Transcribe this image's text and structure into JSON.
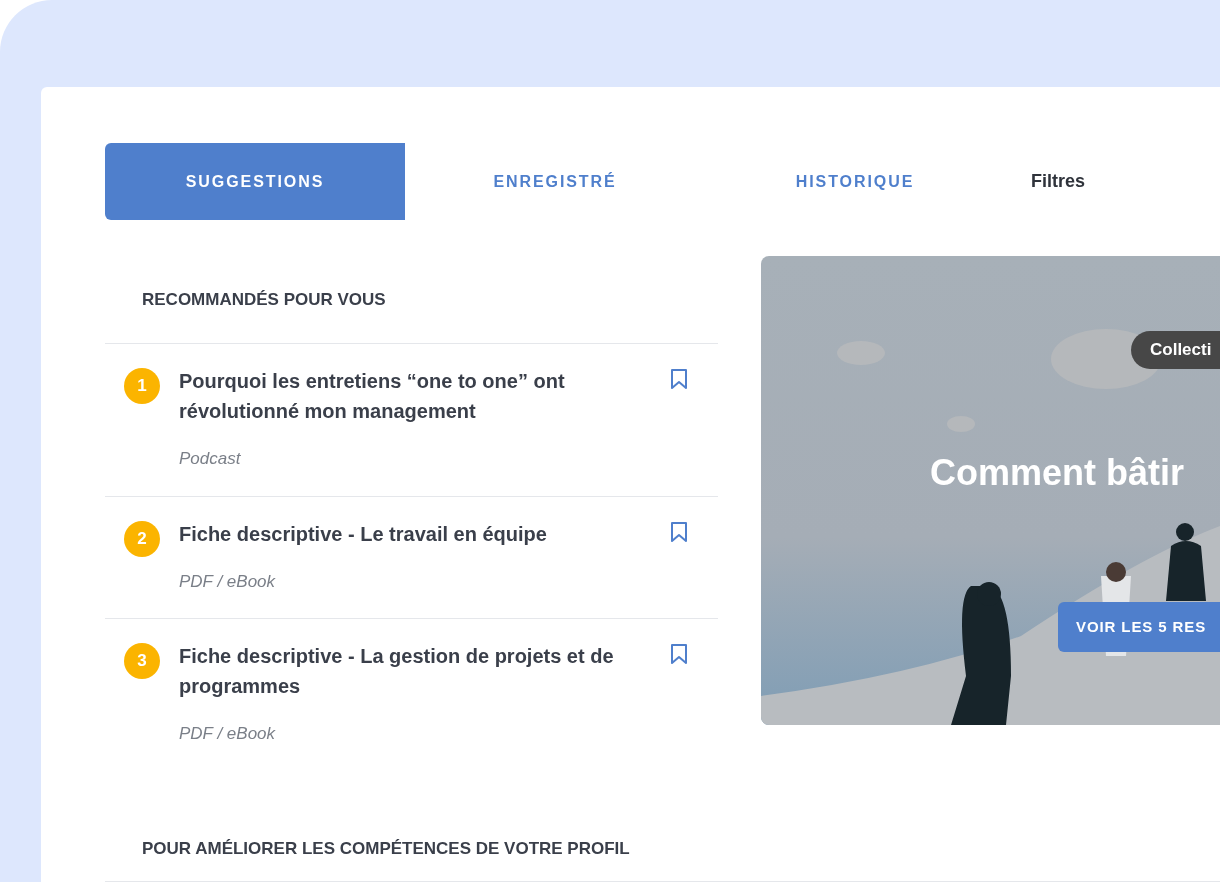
{
  "tabs": [
    {
      "label": "SUGGESTIONS",
      "selected": true
    },
    {
      "label": "ENREGISTRÉ",
      "selected": false
    },
    {
      "label": "HISTORIQUE",
      "selected": false
    }
  ],
  "filters_label": "Filtres",
  "recommended": {
    "heading": "RECOMMANDÉS POUR VOUS",
    "items": [
      {
        "rank": "1",
        "title": "Pourquoi les entretiens “one to one” ont révolutionné mon management",
        "type": "Podcast"
      },
      {
        "rank": "2",
        "title": "Fiche descriptive - Le travail en équipe",
        "type": "PDF / eBook"
      },
      {
        "rank": "3",
        "title": "Fiche descriptive - La gestion de projets et de programmes",
        "type": "PDF / eBook"
      }
    ]
  },
  "collection_card": {
    "badge": "Collecti",
    "title": "Comment bâtir",
    "button": "VOIR LES 5 RES"
  },
  "skills_section": {
    "heading": "POUR AMÉLIORER LES COMPÉTENCES DE VOTRE PROFIL"
  }
}
